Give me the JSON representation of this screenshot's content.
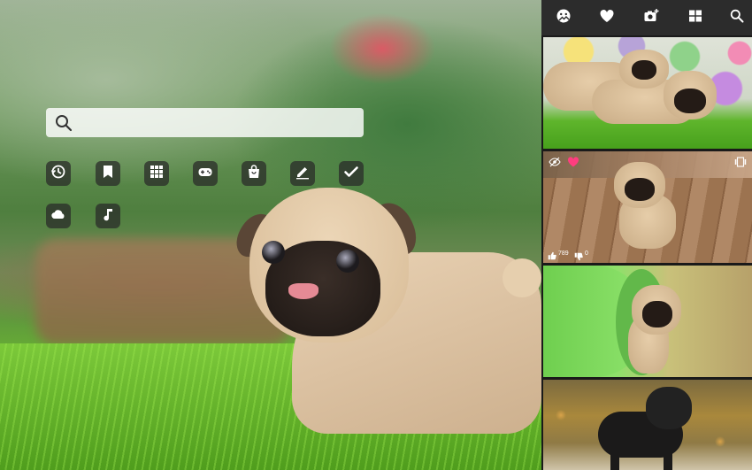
{
  "search": {
    "value": "",
    "placeholder": ""
  },
  "apps": [
    {
      "name": "history-icon"
    },
    {
      "name": "bookmark-icon"
    },
    {
      "name": "apps-grid-icon"
    },
    {
      "name": "gamepad-icon"
    },
    {
      "name": "shopping-bag-icon"
    },
    {
      "name": "edit-icon"
    },
    {
      "name": "checkmark-icon"
    },
    {
      "name": "weather-cloud-icon"
    },
    {
      "name": "music-note-icon"
    }
  ],
  "sidebar": {
    "toolbar_icons": [
      "mood-image-icon",
      "heart-icon",
      "add-photo-icon",
      "tiles-icon",
      "search-icon"
    ],
    "thumbnails": [
      {
        "name": "thumbnail-pugs-easter-eggs"
      },
      {
        "name": "thumbnail-pug-wooden-floor",
        "likes": "789",
        "dislikes": "0",
        "overlay_icons": [
          "hide-icon",
          "heart-icon",
          "wallpaper-icon",
          "thumbs-up-icon",
          "thumbs-down-icon"
        ]
      },
      {
        "name": "thumbnail-pug-green-tunnel"
      },
      {
        "name": "thumbnail-black-pug-autumn"
      }
    ]
  },
  "colors": {
    "sidebar_bg": "#1a1a1a",
    "toolbar_bg": "#2c2c2c",
    "heart_active": "#ff3d7f",
    "icon_tile": "#282828"
  }
}
